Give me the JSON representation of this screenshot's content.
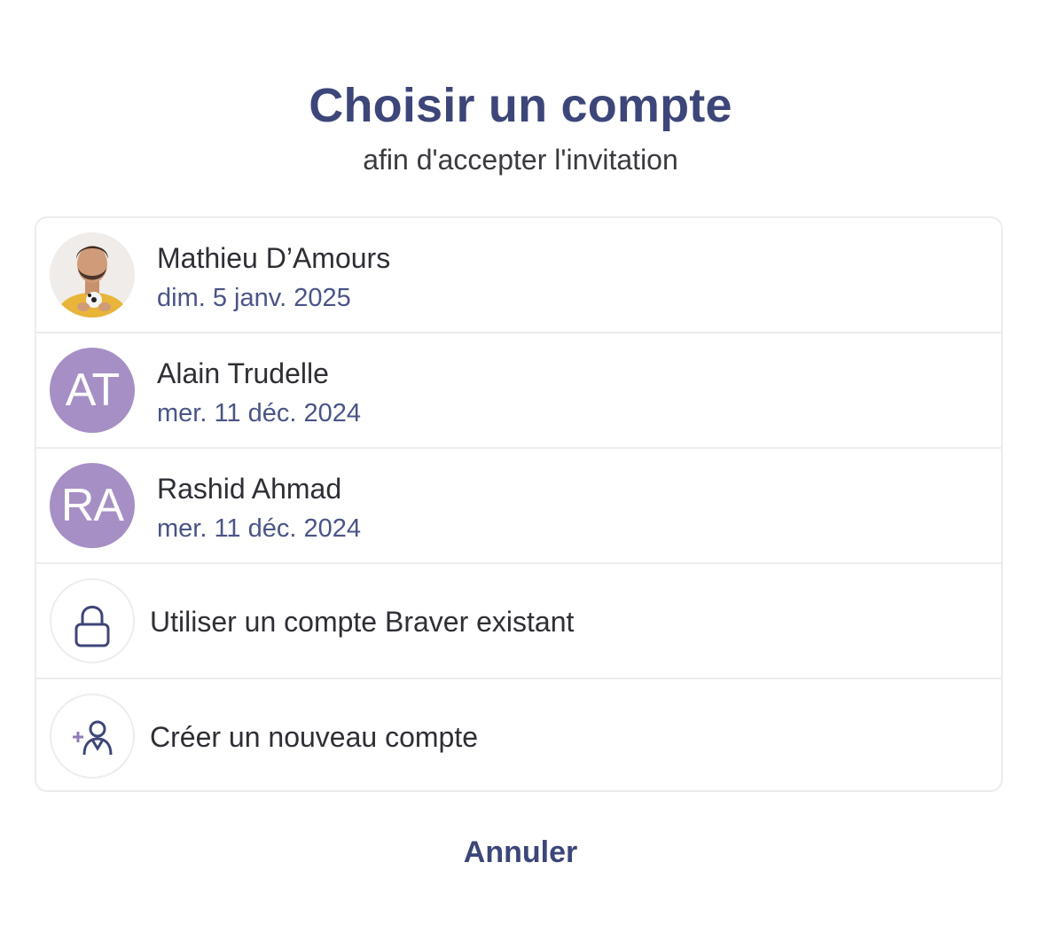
{
  "header": {
    "title": "Choisir un compte",
    "subtitle": "afin d'accepter l'invitation"
  },
  "accounts": [
    {
      "name": "Mathieu D’Amours",
      "date": "dim. 5 janv. 2025",
      "avatar": "photo"
    },
    {
      "name": "Alain Trudelle",
      "date": "mer. 11 déc. 2024",
      "initials": "AT"
    },
    {
      "name": "Rashid Ahmad",
      "date": "mer. 11 déc. 2024",
      "initials": "RA"
    }
  ],
  "actions": {
    "existing_label": "Utiliser un compte Braver existant",
    "existing_icon": "lock-icon",
    "create_label": "Créer un nouveau compte",
    "create_icon": "add-user-icon"
  },
  "cancel_label": "Annuler",
  "colors": {
    "primary": "#3d4679",
    "avatar_bg": "#a58fc4",
    "date_text": "#4a5487",
    "border": "#ececf0"
  }
}
